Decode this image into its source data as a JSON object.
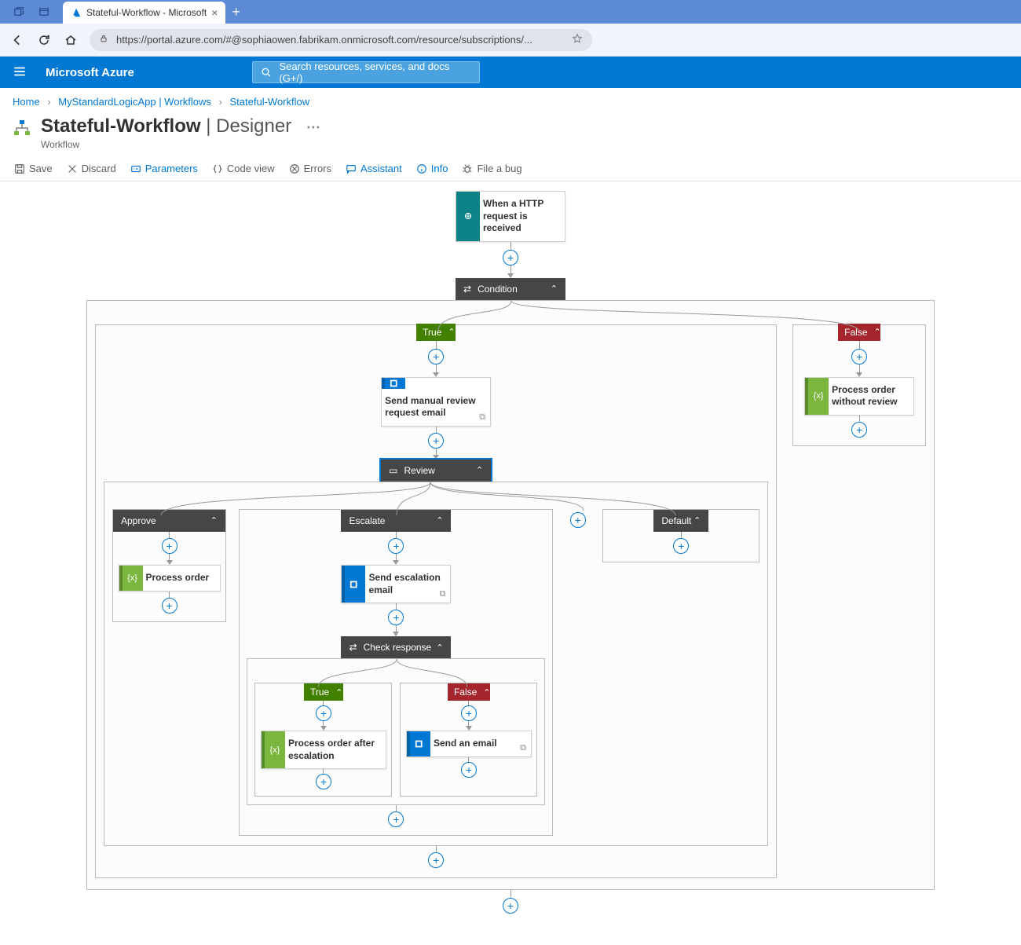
{
  "browser": {
    "tab_title": "Stateful-Workflow - Microsoft",
    "url": "https://portal.azure.com/#@sophiaowen.fabrikam.onmicrosoft.com/resource/subscriptions/..."
  },
  "azure": {
    "brand": "Microsoft Azure",
    "search_placeholder": "Search resources, services, and docs (G+/)"
  },
  "breadcrumb": {
    "items": [
      "Home",
      "MyStandardLogicApp | Workflows",
      "Stateful-Workflow"
    ]
  },
  "page": {
    "title_main": "Stateful-Workflow",
    "title_sep": " | ",
    "title_light": "Designer",
    "subtitle": "Workflow"
  },
  "toolbar": {
    "save": "Save",
    "discard": "Discard",
    "parameters": "Parameters",
    "code_view": "Code view",
    "errors": "Errors",
    "assistant": "Assistant",
    "info": "Info",
    "file_bug": "File a bug"
  },
  "workflow": {
    "trigger": "When a HTTP request is received",
    "condition": "Condition",
    "true": "True",
    "false": "False",
    "send_manual_review": "Send manual review request email",
    "review": "Review",
    "approve": "Approve",
    "escalate": "Escalate",
    "default": "Default",
    "process_order": "Process order",
    "send_escalation": "Send escalation email",
    "check_response": "Check response",
    "process_order_after_escalation": "Process order after escalation",
    "send_an_email": "Send an email",
    "process_order_without_review": "Process order without review"
  }
}
